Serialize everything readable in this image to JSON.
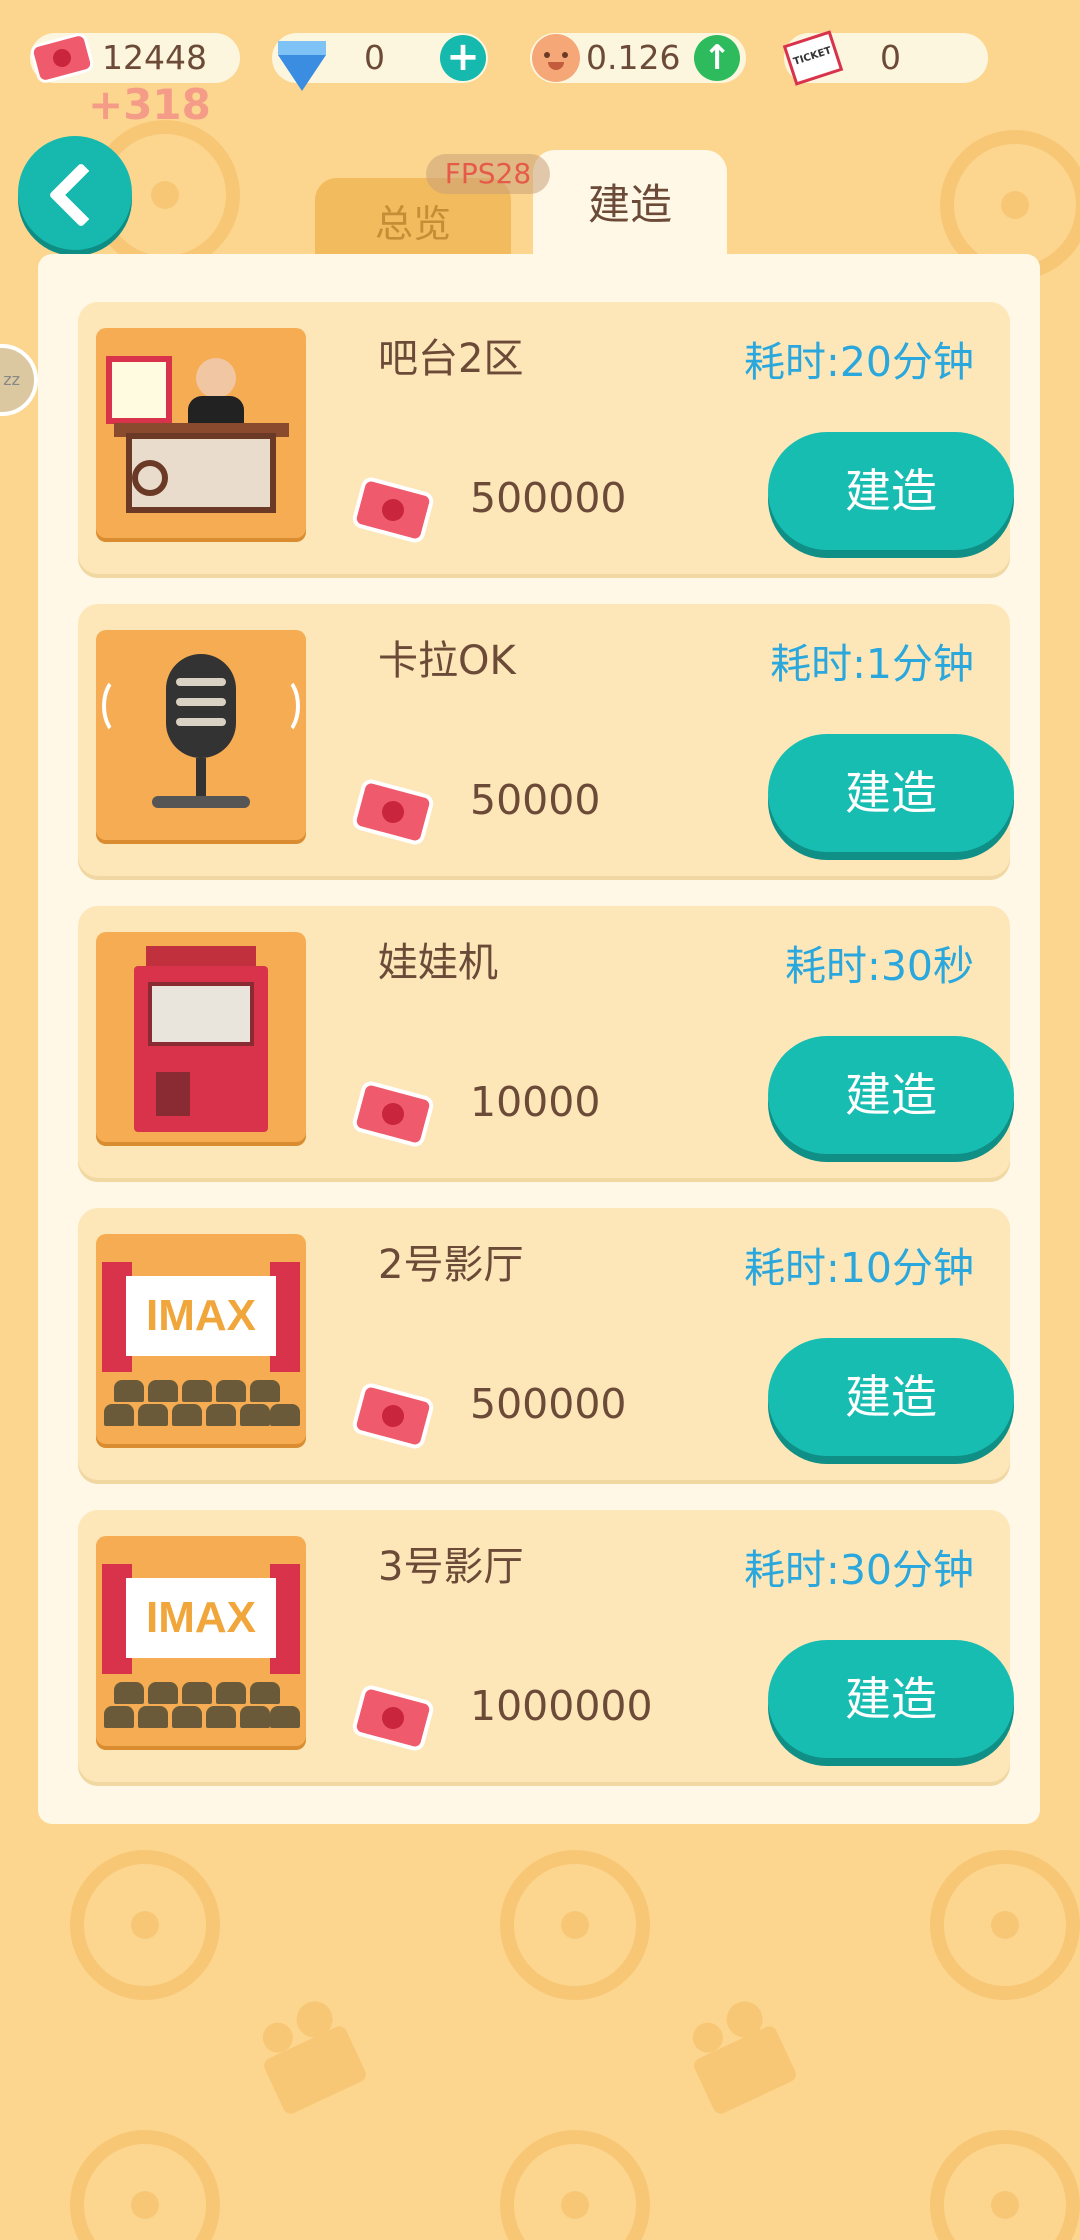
{
  "top_bar": {
    "cash": "12448",
    "gems": "0",
    "rate": "0.126",
    "tickets": "0",
    "income_popup": "+318"
  },
  "debug": {
    "fps": "FPS28"
  },
  "tabs": [
    {
      "label": "总览",
      "active": false
    },
    {
      "label": "建造",
      "active": true
    }
  ],
  "items": [
    {
      "name": "吧台2区",
      "price": "500000",
      "time": "耗时:20分钟",
      "button": "建造",
      "art": "snack-bar"
    },
    {
      "name": "卡拉OK",
      "price": "50000",
      "time": "耗时:1分钟",
      "button": "建造",
      "art": "microphone"
    },
    {
      "name": "娃娃机",
      "price": "10000",
      "time": "耗时:30秒",
      "button": "建造",
      "art": "claw-machine"
    },
    {
      "name": "2号影厅",
      "price": "500000",
      "time": "耗时:10分钟",
      "button": "建造",
      "art": "imax-hall"
    },
    {
      "name": "3号影厅",
      "price": "1000000",
      "time": "耗时:30分钟",
      "button": "建造",
      "art": "imax-hall"
    }
  ],
  "thumb_text": {
    "imax": "IMAX",
    "ticket": "TICKET"
  },
  "colors": {
    "background": "#fcd68f",
    "accent": "#17bdb1",
    "time_text": "#2aa7dc",
    "card": "#fde7b9",
    "panel": "#fff8e6"
  }
}
